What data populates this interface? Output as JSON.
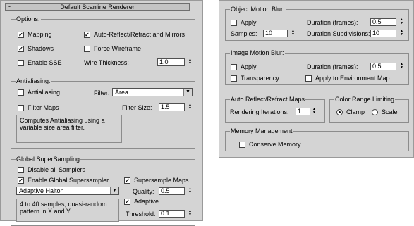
{
  "left_panel": {
    "rollout_minus": "-",
    "rollout_title": "Default Scanline Renderer",
    "options": {
      "label": "Options:",
      "mapping": {
        "label": "Mapping",
        "checked": true
      },
      "auto_reflect": {
        "label": "Auto-Reflect/Refract and Mirrors",
        "checked": true
      },
      "shadows": {
        "label": "Shadows",
        "checked": true
      },
      "force_wireframe": {
        "label": "Force Wireframe",
        "checked": false
      },
      "enable_sse": {
        "label": "Enable SSE",
        "checked": false
      },
      "wire_thickness_label": "Wire Thickness:",
      "wire_thickness_value": "1.0"
    },
    "antialiasing": {
      "label": "Antialiasing:",
      "antialiasing": {
        "label": "Antialiasing",
        "checked": false
      },
      "filter_label": "Filter:",
      "filter_value": "Area",
      "filter_maps": {
        "label": "Filter Maps",
        "checked": false
      },
      "filter_size_label": "Filter Size:",
      "filter_size_value": "1.5",
      "description": "Computes Antialiasing using a variable size area filter."
    },
    "global_ss": {
      "label": "Global SuperSampling",
      "disable_all": {
        "label": "Disable all Samplers",
        "checked": false
      },
      "enable_global": {
        "label": "Enable Global Supersampler",
        "checked": true
      },
      "supersample_maps": {
        "label": "Supersample Maps",
        "checked": true
      },
      "sampler_value": "Adaptive Halton",
      "quality_label": "Quality:",
      "quality_value": "0.5",
      "adaptive": {
        "label": "Adaptive",
        "checked": true
      },
      "description": "4 to 40 samples, quasi-random pattern in X and Y",
      "threshold_label": "Threshold:",
      "threshold_value": "0.1"
    }
  },
  "right_panel": {
    "object_mb": {
      "label": "Object Motion Blur:",
      "apply": {
        "label": "Apply",
        "checked": false
      },
      "duration_label": "Duration (frames):",
      "duration_value": "0.5",
      "samples_label": "Samples:",
      "samples_value": "10",
      "subdivisions_label": "Duration Subdivisions:",
      "subdivisions_value": "10"
    },
    "image_mb": {
      "label": "Image Motion Blur:",
      "apply": {
        "label": "Apply",
        "checked": false
      },
      "duration_label": "Duration (frames):",
      "duration_value": "0.5",
      "transparency": {
        "label": "Transparency",
        "checked": false
      },
      "apply_env": {
        "label": "Apply to Environment Map",
        "checked": false
      }
    },
    "auto_reflect": {
      "label": "Auto Reflect/Refract Maps",
      "iterations_label": "Rendering Iterations:",
      "iterations_value": "1"
    },
    "color_range": {
      "label": "Color Range Limiting",
      "clamp": {
        "label": "Clamp",
        "selected": true
      },
      "scale": {
        "label": "Scale",
        "selected": false
      }
    },
    "memory": {
      "label": "Memory Management",
      "conserve": {
        "label": "Conserve Memory",
        "checked": false
      }
    }
  }
}
